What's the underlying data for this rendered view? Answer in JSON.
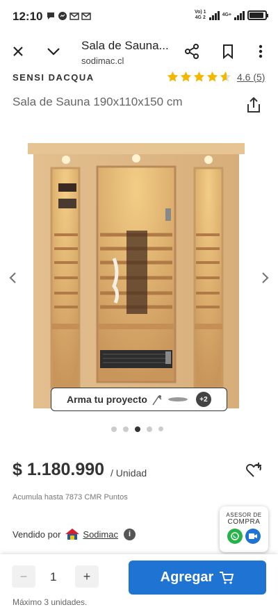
{
  "status_bar": {
    "time": "12:10",
    "network_label_top": "Vo) 1",
    "network_label_bottom": "4G 2",
    "network_label2_top": "4G+",
    "icons": [
      "chat-bubble-icon",
      "messenger-icon",
      "gmail-icon",
      "gmail-icon",
      "signal-icon",
      "battery-icon"
    ]
  },
  "browser": {
    "title": "Sala de Sauna...",
    "url": "sodimac.cl",
    "icons": [
      "close-icon",
      "chevron-down-icon",
      "share-icon",
      "bookmark-icon",
      "more-vertical-icon"
    ]
  },
  "product": {
    "brand": "SENSI DACQUA",
    "rating": 4.6,
    "rating_label": "4.6 (5)",
    "title": "Sala de Sauna 190x110x150 cm",
    "price": "$ 1.180.990",
    "price_unit": "/ Unidad",
    "cmr_points": "Acumula hasta 7873 CMR Puntos",
    "sold_by_label": "Vendido por",
    "seller": "Sodimac"
  },
  "gallery": {
    "project_label": "Arma tu proyecto",
    "more_count": "+2",
    "slide_count": 5,
    "active_slide": 3
  },
  "advisor": {
    "line1": "ASESOR DE",
    "line2": "COMPRA"
  },
  "cart": {
    "minus": "−",
    "plus": "+",
    "quantity": "1",
    "add_label": "Agregar",
    "max_units": "Máximo 3 unidades."
  },
  "colors": {
    "accent": "#1e73d3",
    "star": "#f2b800",
    "whatsapp": "#25b34a",
    "video": "#1e73d3"
  }
}
